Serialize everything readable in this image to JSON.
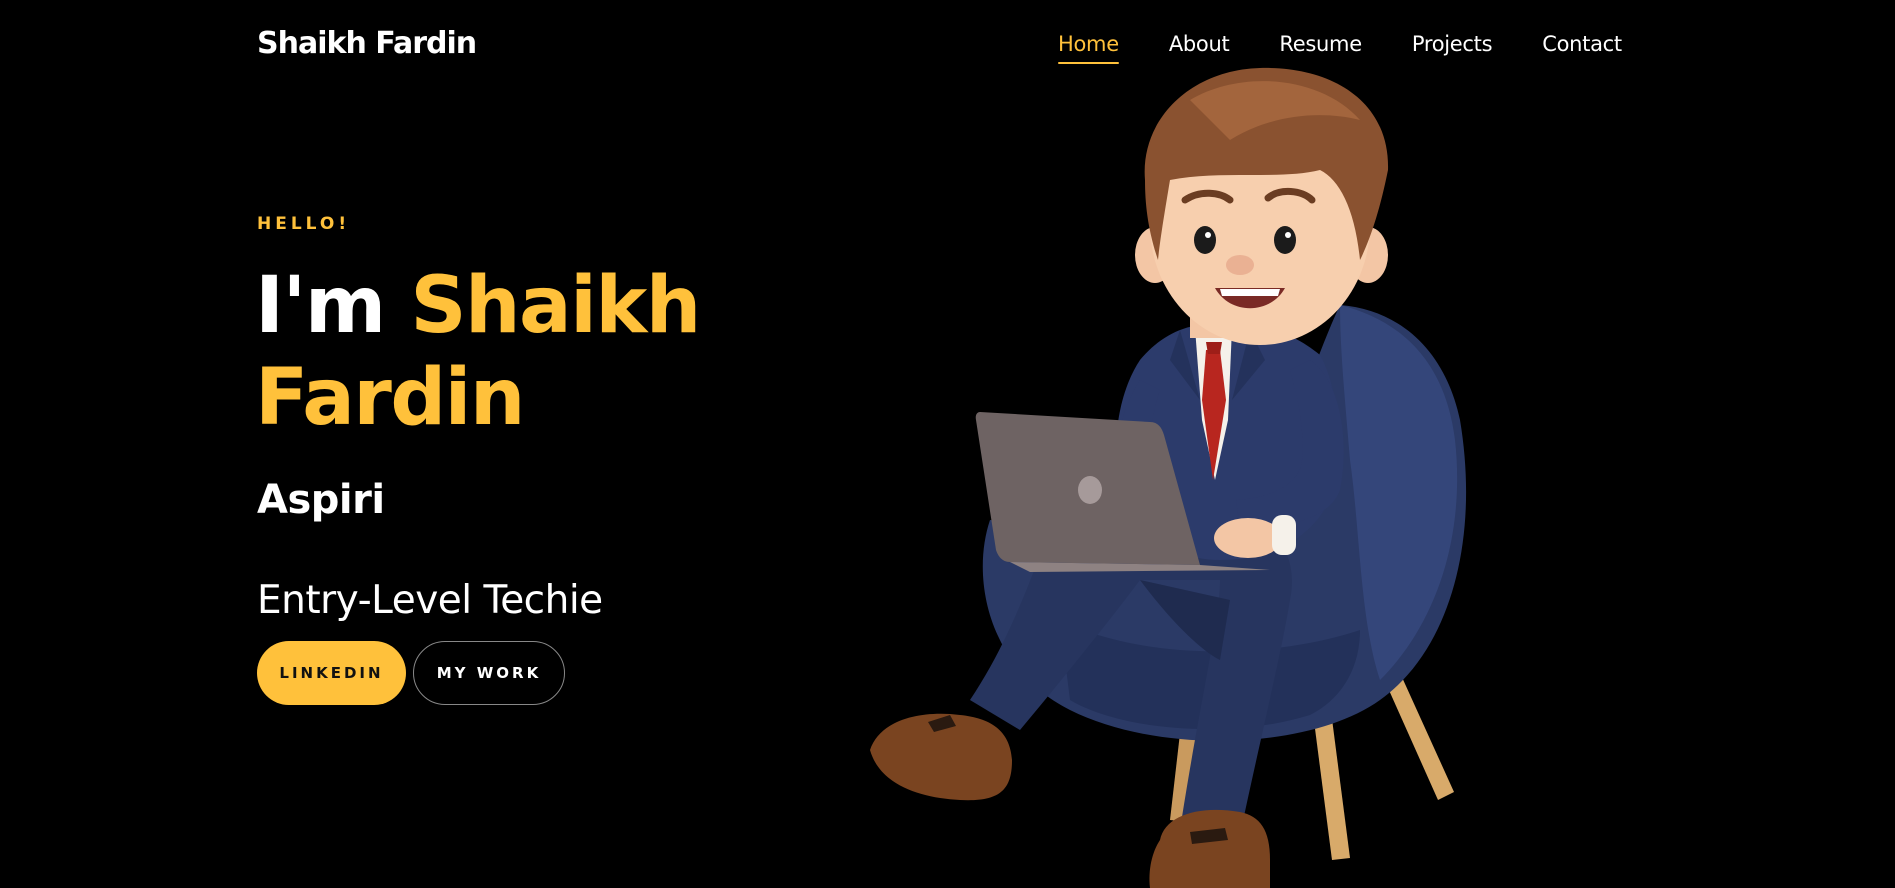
{
  "nav": {
    "brand": "Shaikh Fardin",
    "items": [
      {
        "label": "Home",
        "active": true
      },
      {
        "label": "About",
        "active": false
      },
      {
        "label": "Resume",
        "active": false
      },
      {
        "label": "Projects",
        "active": false
      },
      {
        "label": "Contact",
        "active": false
      }
    ]
  },
  "hero": {
    "greeting": "HELLO!",
    "headline_prefix": "I'm",
    "headline_name_1": "Shaikh",
    "headline_name_2": "Fardin",
    "typed_text": "Aspiri",
    "subtitle": "Entry-Level Techie",
    "buttons": {
      "linkedin": "LINKEDIN",
      "my_work": "MY WORK"
    },
    "illustration": "cartoon-boy-with-laptop-on-chair"
  },
  "colors": {
    "background": "#000000",
    "accent": "#ffc13b",
    "text": "#ffffff"
  }
}
